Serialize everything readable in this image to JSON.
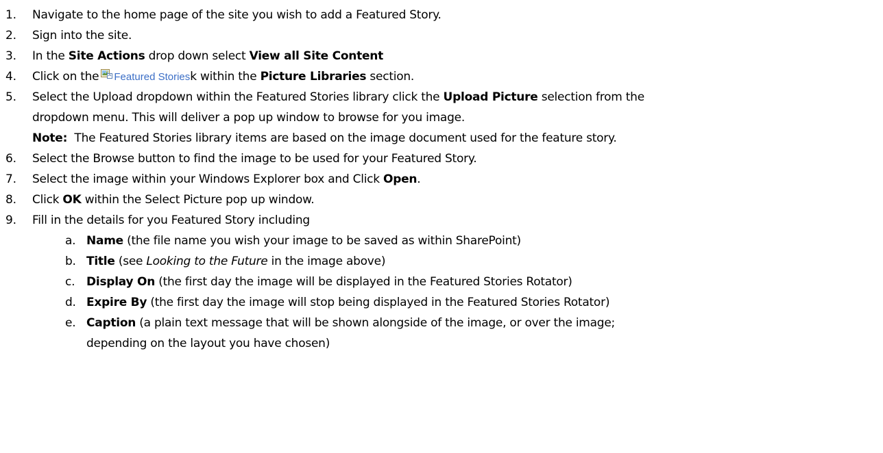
{
  "steps": [
    {
      "num": "1.",
      "text": "Navigate to the home page of the site you wish to add a Featured Story."
    },
    {
      "num": "2.",
      "text": "Sign into the site."
    },
    {
      "num": "3.",
      "pre": "In the ",
      "b1": "Site Actions",
      "mid": " drop down select ",
      "b2": "View all Site Content"
    },
    {
      "num": "4.",
      "pre": "Click on the",
      "link": "Featured Stories",
      "after": "k within the ",
      "b1": "Picture Libraries",
      "post": " section."
    },
    {
      "num": "5.",
      "pre": "Select the Upload dropdown within the Featured Stories library click the ",
      "b1": "Upload Picture",
      "post": " selection from the",
      "line2": "dropdown menu. This will deliver a pop up window to browse for you image.",
      "note_label": "Note:",
      "note_text": "  The Featured Stories library items are based on the image document used for the feature story."
    },
    {
      "num": "6.",
      "text": "Select the Browse button to find the image to be used for your Featured Story."
    },
    {
      "num": "7.",
      "pre": "Select the image within your Windows Explorer box and Click ",
      "b1": "Open",
      "post": "."
    },
    {
      "num": "8.",
      "pre": "Click ",
      "b1": "OK",
      "post": " within the Select Picture pop up window."
    },
    {
      "num": "9.",
      "text": "Fill in the details for you Featured Story including"
    }
  ],
  "substeps": [
    {
      "letter": "a.",
      "b": "Name",
      "text": " (the file name you wish your image to be saved as within SharePoint)"
    },
    {
      "letter": "b.",
      "b": "Title",
      "pre": " (see ",
      "i": "Looking to the Future",
      "post": " in the image above)"
    },
    {
      "letter": "c.",
      "b": "Display On",
      "text": " (the first day the image will be displayed in the Featured Stories Rotator)"
    },
    {
      "letter": "d.",
      "b": "Expire By",
      "text": " (the first day the image will stop being displayed in the Featured Stories Rotator)"
    },
    {
      "letter": "e.",
      "b": "Caption",
      "text": " (a plain text message that will be shown alongside of the image, or over the image;",
      "line2": "depending on the layout you have chosen)"
    }
  ],
  "icons": {
    "picture_library": "picture-library-icon"
  },
  "colors": {
    "link": "#3b6ec6"
  }
}
